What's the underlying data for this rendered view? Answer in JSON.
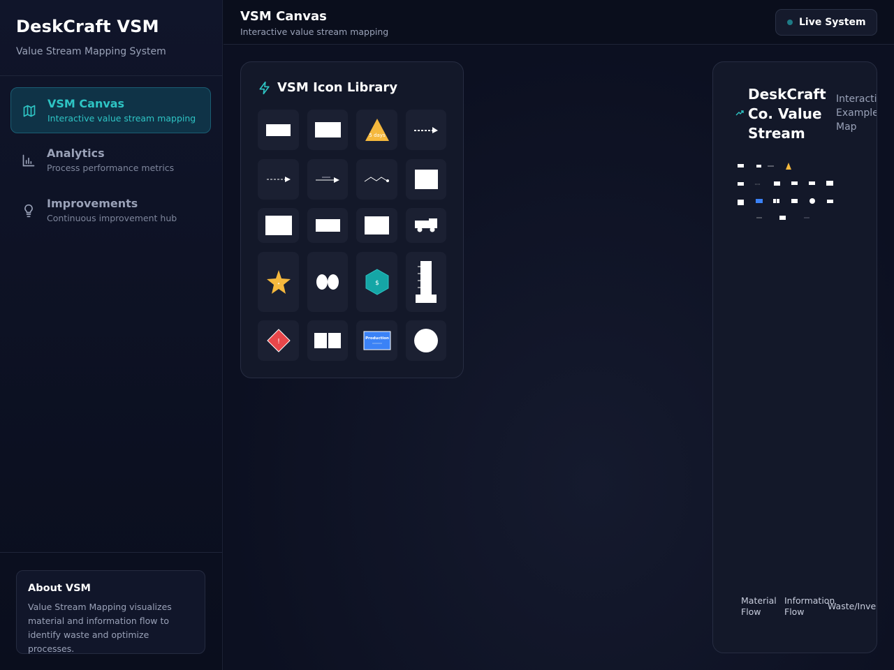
{
  "sidebar": {
    "title": "DeskCraft VSM",
    "subtitle": "Value Stream Mapping System",
    "items": [
      {
        "label": "VSM Canvas",
        "sub": "Interactive value stream mapping",
        "icon": "map-icon"
      },
      {
        "label": "Analytics",
        "sub": "Process performance metrics",
        "icon": "bar-chart-icon"
      },
      {
        "label": "Improvements",
        "sub": "Continuous improvement hub",
        "icon": "lightbulb-icon"
      }
    ],
    "about": {
      "title": "About VSM",
      "text": "Value Stream Mapping visualizes material and information flow to identify waste and optimize processes."
    }
  },
  "header": {
    "title": "VSM Canvas",
    "subtitle": "Interactive value stream mapping",
    "status": "Live System"
  },
  "library": {
    "title": "VSM Icon Library",
    "inventory_label": "5 days",
    "kaizen_label": "!",
    "supermarket_label": "$",
    "production_control_label": "Production"
  },
  "example": {
    "title": "DeskCraft Co. Value Stream",
    "side_text": "Interactive Example Map",
    "legend": [
      "Material Flow",
      "Information Flow",
      "Waste/Inventory"
    ]
  },
  "colors": {
    "accent": "#2ec4c4",
    "warning": "#f5b83d",
    "danger": "#e8474a",
    "info": "#3b82f6"
  }
}
